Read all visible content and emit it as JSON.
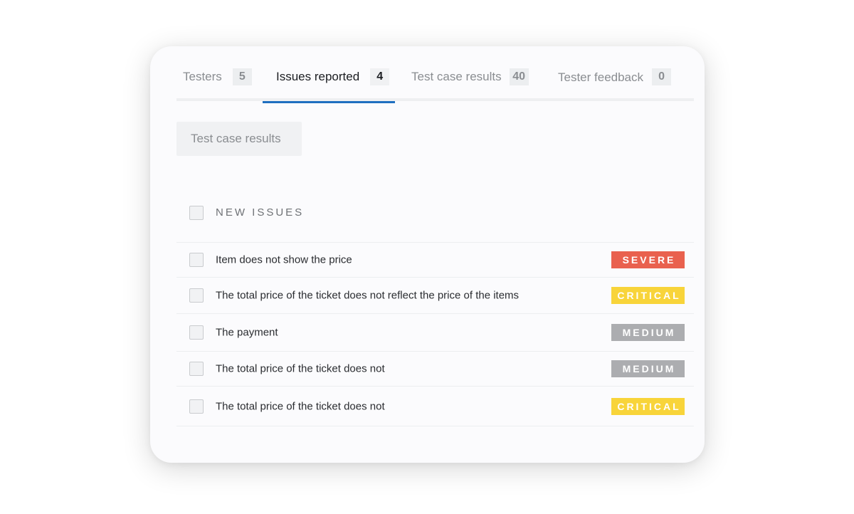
{
  "tabs": [
    {
      "label": "Testers",
      "count": "5",
      "active": false
    },
    {
      "label": "Issues reported",
      "count": "4",
      "active": true
    },
    {
      "label": "Test case results",
      "count": "40",
      "active": false
    },
    {
      "label": "Tester feedback",
      "count": "0",
      "active": false
    }
  ],
  "filter_button": {
    "label": "Test case results"
  },
  "section": {
    "title": "NEW ISSUES"
  },
  "issues": [
    {
      "text": "Item does not show the price",
      "severity": "SEVERE",
      "color": "#e9614e"
    },
    {
      "text": "The total price of the ticket does not reflect the price of the items",
      "severity": "CRITICAL",
      "color": "#f8d43a"
    },
    {
      "text": "The payment",
      "severity": "MEDIUM",
      "color": "#acadb0"
    },
    {
      "text": "The total price of the ticket does not",
      "severity": "MEDIUM",
      "color": "#acadb0"
    },
    {
      "text": "The total price of the ticket does not",
      "severity": "CRITICAL",
      "color": "#f8d43a"
    }
  ],
  "colors": {
    "accent": "#1f6fc0",
    "severe": "#e9614e",
    "critical": "#f8d43a",
    "medium": "#acadb0"
  }
}
